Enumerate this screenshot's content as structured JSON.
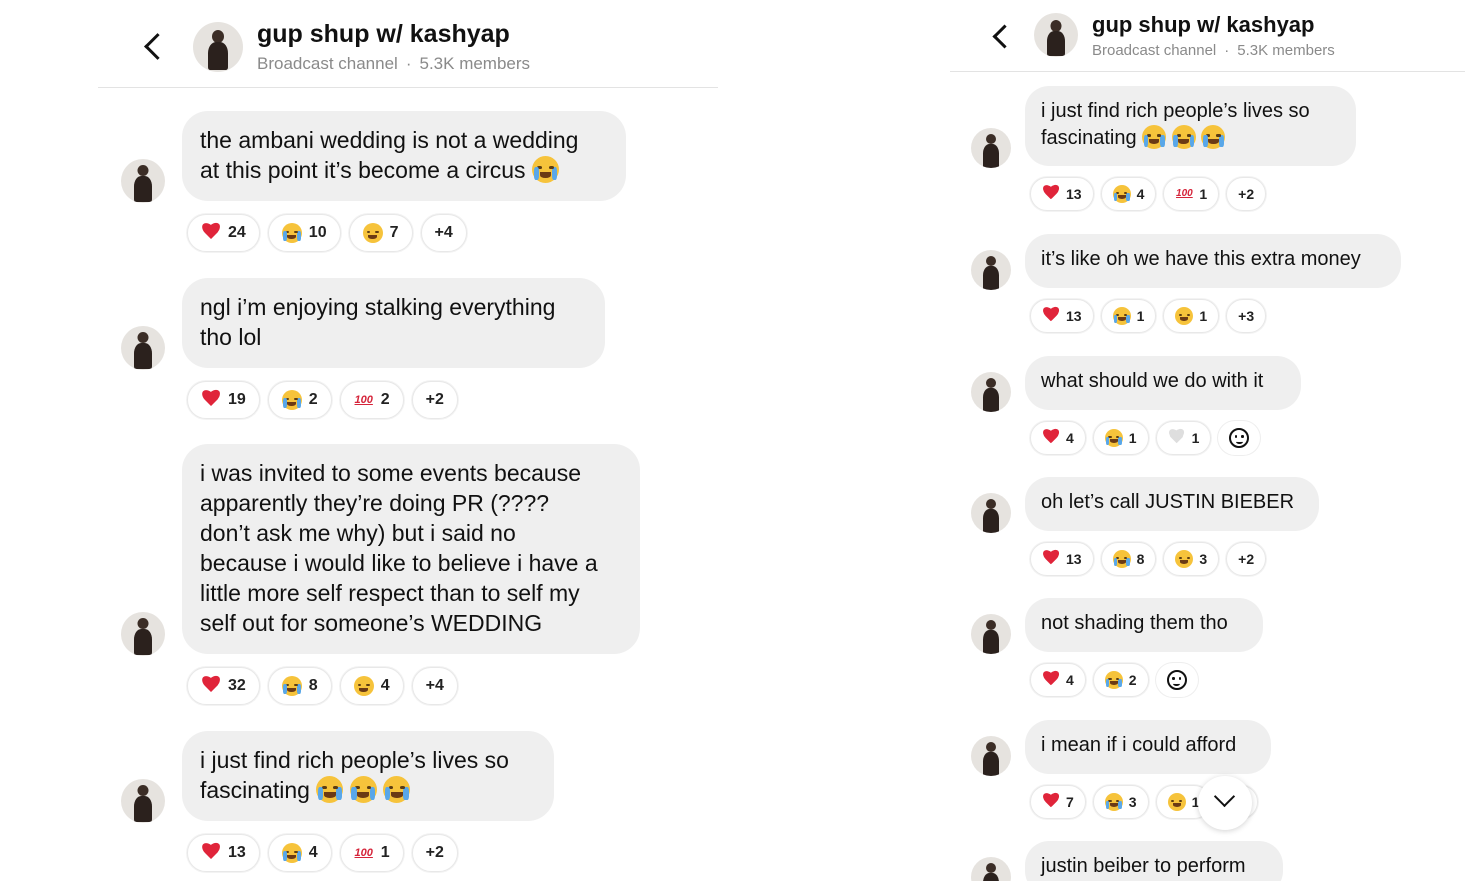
{
  "channel": {
    "name": "gup shup w/ kashyap",
    "type": "Broadcast channel",
    "members": "5.3K members"
  },
  "left_messages": [
    {
      "lines": [
        "the ambani wedding is not a wedding",
        "at this point it’s become a circus"
      ],
      "trailing_emoji": [
        "crying-face"
      ],
      "reactions": [
        {
          "icon": "red-heart",
          "count": "24"
        },
        {
          "icon": "laughing-tears",
          "count": "10"
        },
        {
          "icon": "grinning-face",
          "count": "7"
        },
        {
          "icon": "more",
          "count": "+4"
        }
      ]
    },
    {
      "lines": [
        "ngl i’m enjoying stalking everything",
        "tho lol"
      ],
      "trailing_emoji": [],
      "reactions": [
        {
          "icon": "red-heart",
          "count": "19"
        },
        {
          "icon": "laughing-tears",
          "count": "2"
        },
        {
          "icon": "hundred-points",
          "count": "2"
        },
        {
          "icon": "more",
          "count": "+2"
        }
      ]
    },
    {
      "lines": [
        "i was invited to some events because",
        "apparently they’re doing PR (????",
        "don’t ask me why) but i said no",
        "because i would like to believe i have a",
        "little more self respect than to self my",
        "self out for someone’s WEDDING"
      ],
      "trailing_emoji": [],
      "reactions": [
        {
          "icon": "red-heart",
          "count": "32"
        },
        {
          "icon": "laughing-tears",
          "count": "8"
        },
        {
          "icon": "grinning-face",
          "count": "4"
        },
        {
          "icon": "more",
          "count": "+4"
        }
      ]
    },
    {
      "lines": [
        "i just find rich people’s lives so",
        "fascinating"
      ],
      "trailing_emoji": [
        "crying-face",
        "crying-face",
        "crying-face"
      ],
      "reactions": [
        {
          "icon": "red-heart",
          "count": "13"
        },
        {
          "icon": "laughing-tears",
          "count": "4"
        },
        {
          "icon": "hundred-points",
          "count": "1"
        },
        {
          "icon": "more",
          "count": "+2"
        }
      ]
    }
  ],
  "right_messages": [
    {
      "lines": [
        "i just find rich people’s lives so",
        "fascinating"
      ],
      "trailing_emoji": [
        "crying-face",
        "crying-face",
        "crying-face"
      ],
      "reactions": [
        {
          "icon": "red-heart",
          "count": "13"
        },
        {
          "icon": "laughing-tears",
          "count": "4"
        },
        {
          "icon": "hundred-points",
          "count": "1"
        },
        {
          "icon": "more",
          "count": "+2"
        }
      ]
    },
    {
      "lines": [
        "it’s like oh we have this extra money"
      ],
      "trailing_emoji": [],
      "reactions": [
        {
          "icon": "red-heart",
          "count": "13"
        },
        {
          "icon": "laughing-tears",
          "count": "1"
        },
        {
          "icon": "grinning-face",
          "count": "1"
        },
        {
          "icon": "more",
          "count": "+3"
        }
      ]
    },
    {
      "lines": [
        "what should we do with it"
      ],
      "trailing_emoji": [],
      "reactions": [
        {
          "icon": "red-heart",
          "count": "4"
        },
        {
          "icon": "laughing-tears",
          "count": "1"
        },
        {
          "icon": "white-heart",
          "count": "1"
        },
        {
          "icon": "add-reaction",
          "count": ""
        }
      ]
    },
    {
      "lines": [
        "oh let’s call JUSTIN BIEBER"
      ],
      "trailing_emoji": [],
      "reactions": [
        {
          "icon": "red-heart",
          "count": "13"
        },
        {
          "icon": "laughing-tears",
          "count": "8"
        },
        {
          "icon": "grinning-face",
          "count": "3"
        },
        {
          "icon": "more",
          "count": "+2"
        }
      ]
    },
    {
      "lines": [
        "not shading them tho"
      ],
      "trailing_emoji": [],
      "reactions": [
        {
          "icon": "red-heart",
          "count": "4"
        },
        {
          "icon": "laughing-tears",
          "count": "2"
        },
        {
          "icon": "add-reaction",
          "count": ""
        }
      ]
    },
    {
      "lines": [
        "i mean if i could afford"
      ],
      "trailing_emoji": [],
      "reactions": [
        {
          "icon": "red-heart",
          "count": "7"
        },
        {
          "icon": "laughing-tears",
          "count": "3"
        },
        {
          "icon": "grinning-face",
          "count": "1"
        },
        {
          "icon": "more",
          "count": "+1"
        }
      ]
    },
    {
      "lines": [
        "justin beiber to perform"
      ],
      "trailing_emoji": [],
      "reactions": []
    }
  ]
}
